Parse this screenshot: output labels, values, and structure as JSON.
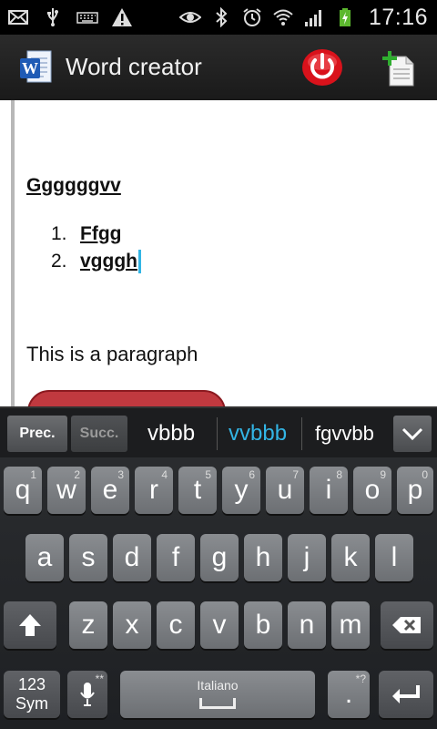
{
  "status_bar": {
    "time": "17:16",
    "left_icons": [
      "mail-icon",
      "usb-icon",
      "keyboard-icon",
      "warning-icon"
    ],
    "right_icons": [
      "eye-icon",
      "bluetooth-icon",
      "alarm-icon",
      "wifi-icon",
      "signal-icon",
      "battery-charging-icon"
    ]
  },
  "action_bar": {
    "title": "Word creator",
    "app_icon": "word-doc-icon",
    "power_icon": "power-icon",
    "new_doc_icon": "new-document-icon"
  },
  "document": {
    "heading": "Ggggggvv",
    "list": [
      {
        "num": "1.",
        "text": "Ffgg"
      },
      {
        "num": "2.",
        "text": "vgggh"
      }
    ],
    "paragraph": "This is a paragraph"
  },
  "suggestions": {
    "prev_label": "Prec.",
    "next_label": "Succ.",
    "words": [
      "vbbb",
      "vvbbb",
      "fgvvbb"
    ],
    "highlight_color": "#33b5e5",
    "expand_icon": "chevron-down-icon"
  },
  "keyboard": {
    "row1": [
      {
        "k": "q",
        "h": "1"
      },
      {
        "k": "w",
        "h": "2"
      },
      {
        "k": "e",
        "h": "3"
      },
      {
        "k": "r",
        "h": "4"
      },
      {
        "k": "t",
        "h": "5"
      },
      {
        "k": "y",
        "h": "6"
      },
      {
        "k": "u",
        "h": "7"
      },
      {
        "k": "i",
        "h": "8"
      },
      {
        "k": "o",
        "h": "9"
      },
      {
        "k": "p",
        "h": "0"
      }
    ],
    "row2": [
      "a",
      "s",
      "d",
      "f",
      "g",
      "h",
      "j",
      "k",
      "l"
    ],
    "row3": [
      "z",
      "x",
      "c",
      "v",
      "b",
      "n",
      "m"
    ],
    "sym_line1": "123",
    "sym_line2": "Sym",
    "space_label": "Italiano",
    "period": ".",
    "mic_hint": "**",
    "period_hint": "*?",
    "shift_icon": "shift-arrow-icon",
    "backspace_icon": "backspace-icon",
    "enter_icon": "enter-icon",
    "mic_icon": "microphone-icon"
  }
}
